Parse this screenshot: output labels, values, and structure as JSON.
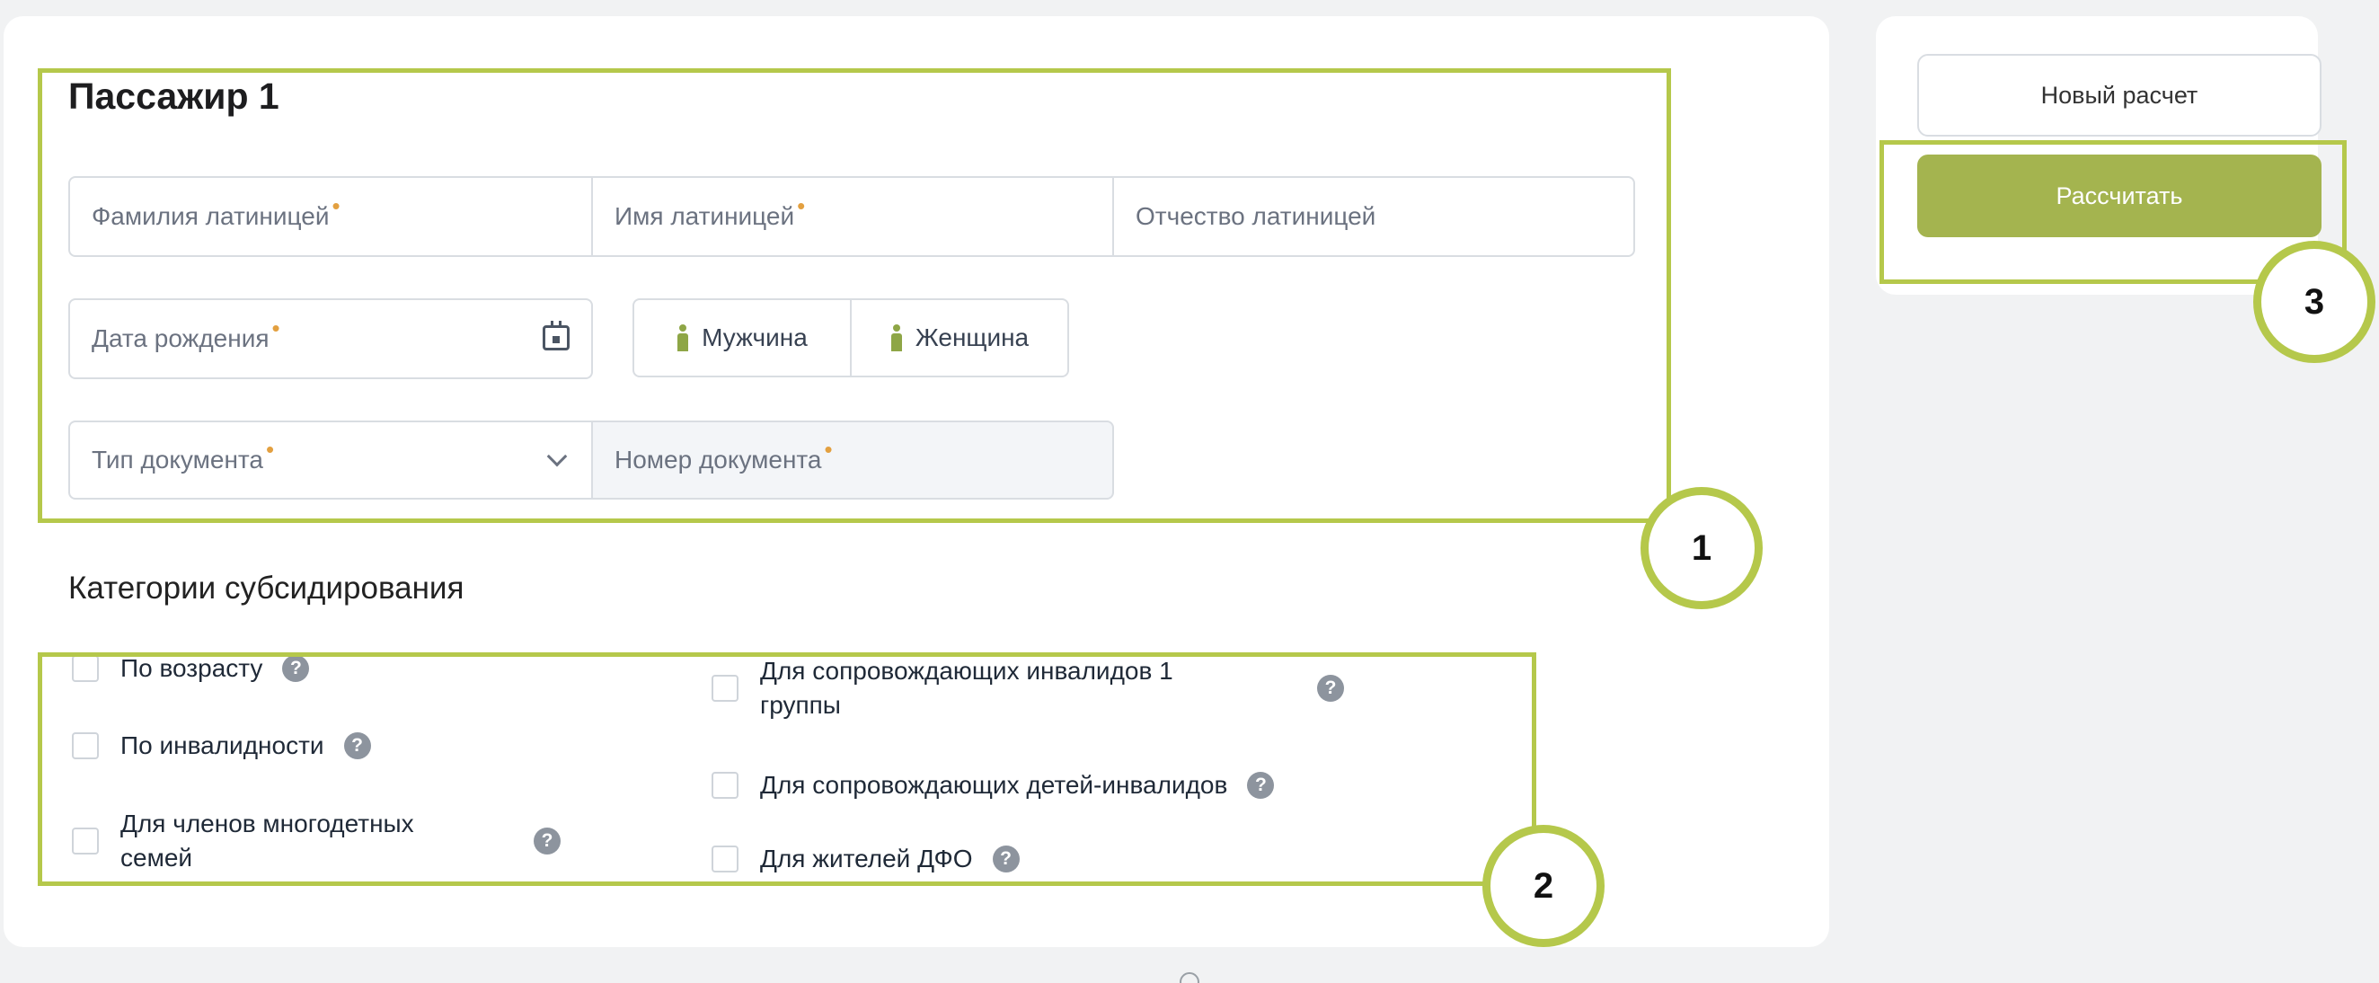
{
  "passenger": {
    "title": "Пассажир 1",
    "lastname_placeholder": "Фамилия латиницей",
    "firstname_placeholder": "Имя латиницей",
    "middlename_placeholder": "Отчество латиницей",
    "birthdate_placeholder": "Дата рождения",
    "gender_male": "Мужчина",
    "gender_female": "Женщина",
    "doc_type_placeholder": "Тип документа",
    "doc_number_placeholder": "Номер документа",
    "required_mark": "•"
  },
  "subsidies": {
    "title": "Категории субсидирования",
    "left": [
      {
        "label": "По возрасту"
      },
      {
        "label": "По инвалидности"
      },
      {
        "label_line1": "Для членов многодетных",
        "label_line2": "семей"
      }
    ],
    "right": [
      {
        "label_line1": "Для сопровождающих инвалидов 1",
        "label_line2": "группы"
      },
      {
        "label": "Для сопровождающих детей-инвалидов"
      },
      {
        "label": "Для жителей ДФО"
      }
    ],
    "help_glyph": "?"
  },
  "actions": {
    "new_calc": "Новый расчет",
    "calculate": "Рассчитать"
  },
  "annotations": {
    "badge1": "1",
    "badge2": "2",
    "badge3": "3"
  },
  "colors": {
    "accent": "#a4b44f",
    "highlight": "#b5c84b",
    "required": "#e3a040"
  },
  "icons": {
    "calendar": "calendar-icon",
    "chevron": "chevron-down-icon",
    "male": "male-icon",
    "female": "female-icon",
    "help": "help-icon"
  }
}
